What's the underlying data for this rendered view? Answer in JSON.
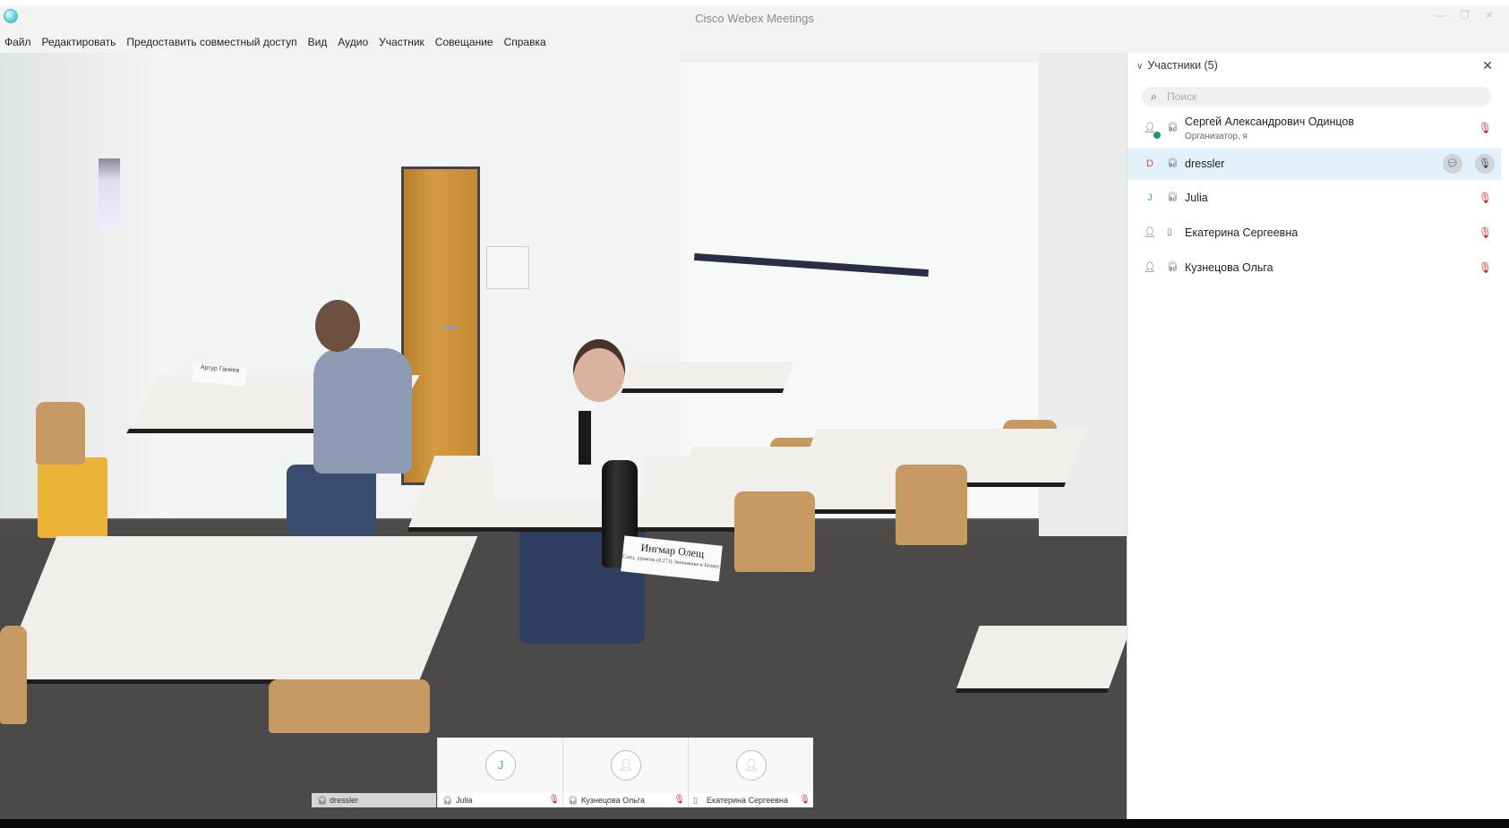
{
  "window": {
    "title": "Cisco Webex Meetings",
    "controls": [
      "—",
      "❐",
      "✕"
    ]
  },
  "menu": [
    "Файл",
    "Редактировать",
    "Предоставить совместный доступ",
    "Вид",
    "Аудио",
    "Участник",
    "Совещание",
    "Справка"
  ],
  "video": {
    "nameplate_main": "Ингмар Олещ",
    "nameplate_main_sub": "Спец. уровень (8 271) Экономика и Бизнес",
    "nameplate_small": "Артур Ганиев"
  },
  "tiles": {
    "self": {
      "name": "dressler",
      "icon": "headset-icon"
    },
    "items": [
      {
        "name": "Julia",
        "avatar": "J",
        "icon": "headset-icon",
        "muted": true
      },
      {
        "name": "Кузнецова Ольга",
        "avatar": "",
        "icon": "headset-icon",
        "muted": true
      },
      {
        "name": "Екатерина Сергеевна",
        "avatar": "",
        "icon": "phone-icon",
        "muted": true
      }
    ]
  },
  "participants_panel": {
    "title": "Участники (5)",
    "search_placeholder": "Поиск",
    "participants": [
      {
        "name": "Сергей Александрович Одинцов",
        "subtitle": "Организатор, я",
        "avatar": "person",
        "device": "headset-icon",
        "muted": true
      },
      {
        "name": "dressler",
        "subtitle": "",
        "avatar": "D",
        "device": "headset-icon",
        "muted": false,
        "selected": true
      },
      {
        "name": "Julia",
        "subtitle": "",
        "avatar": "J",
        "device": "headset-icon",
        "muted": true
      },
      {
        "name": "Екатерина Сергеевна",
        "subtitle": "",
        "avatar": "person",
        "device": "phone-icon",
        "muted": true
      },
      {
        "name": "Кузнецова Ольга",
        "subtitle": "",
        "avatar": "person",
        "device": "headset-icon",
        "muted": true
      }
    ]
  },
  "colors": {
    "accent": "#4aa0d8",
    "mute": "#d22222",
    "host_badge": "#1a9e5a",
    "selected_row": "#e3f1fa"
  }
}
